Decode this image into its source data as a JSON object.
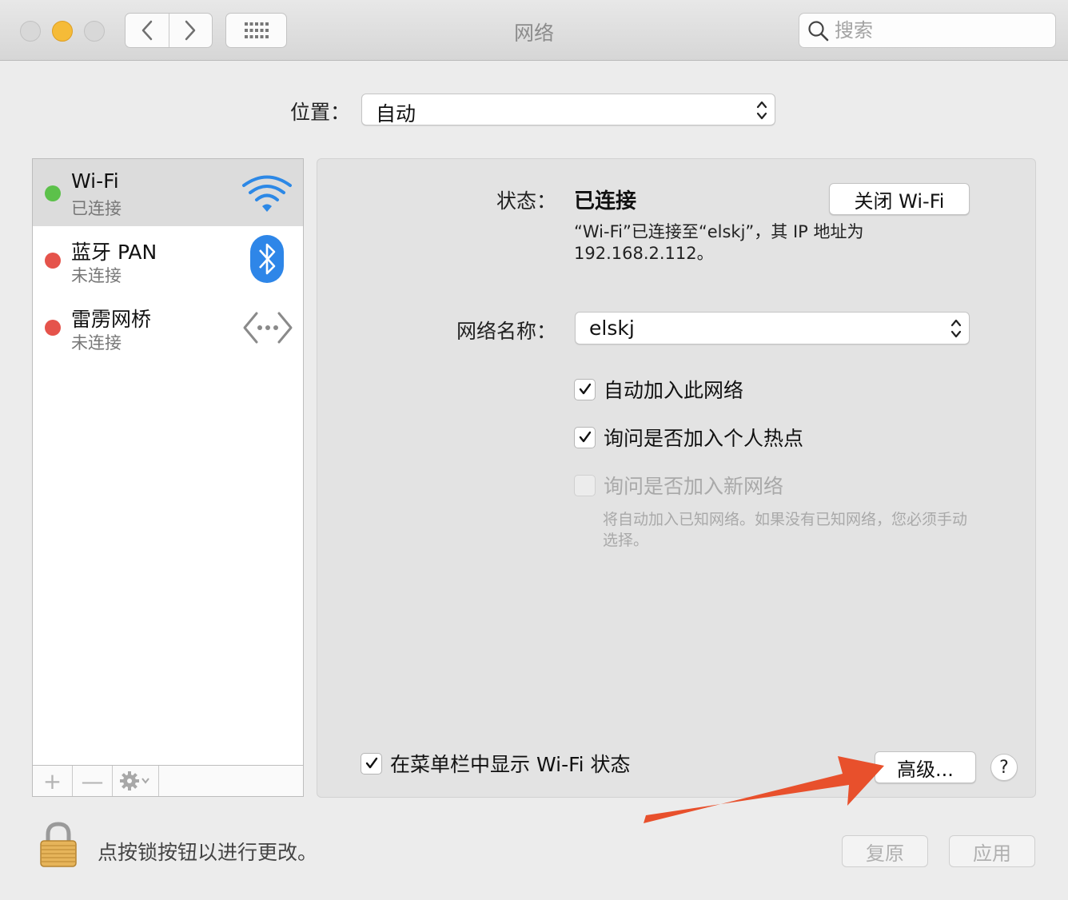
{
  "window": {
    "title": "网络"
  },
  "search": {
    "placeholder": "搜索"
  },
  "location": {
    "label": "位置：",
    "value": "自动"
  },
  "services": [
    {
      "name": "Wi-Fi",
      "status": "已连接",
      "status_color": "#5cc14a",
      "icon": "wifi-icon",
      "selected": true
    },
    {
      "name": "蓝牙 PAN",
      "status": "未连接",
      "status_color": "#e5534b",
      "icon": "bluetooth-icon",
      "selected": false
    },
    {
      "name": "雷雳网桥",
      "status": "未连接",
      "status_color": "#e5534b",
      "icon": "thunderbolt-bridge-icon",
      "selected": false
    }
  ],
  "service_toolbar": {
    "add": "+",
    "remove": "—"
  },
  "detail": {
    "status_label": "状态：",
    "status_value": "已连接",
    "turn_off_button": "关闭 Wi-Fi",
    "status_description": "“Wi-Fi”已连接至“elskj”，其 IP 地址为 192.168.2.112。",
    "network_name_label": "网络名称：",
    "network_name_value": "elskj",
    "options": [
      {
        "label": "自动加入此网络",
        "checked": true,
        "enabled": true
      },
      {
        "label": "询问是否加入个人热点",
        "checked": true,
        "enabled": true
      },
      {
        "label": "询问是否加入新网络",
        "checked": false,
        "enabled": false
      }
    ],
    "hint": "将自动加入已知网络。如果没有已知网络，您必须手动选择。",
    "show_in_menubar_label": "在菜单栏中显示 Wi-Fi 状态",
    "show_in_menubar_checked": true,
    "advanced_button": "高级...",
    "help_button": "?"
  },
  "footer": {
    "lock_text": "点按锁按钮以进行更改。",
    "revert_button": "复原",
    "apply_button": "应用"
  },
  "colors": {
    "annotation_arrow": "#e8502c",
    "status_connected": "#5cc14a",
    "status_disconnected": "#e5534b"
  }
}
